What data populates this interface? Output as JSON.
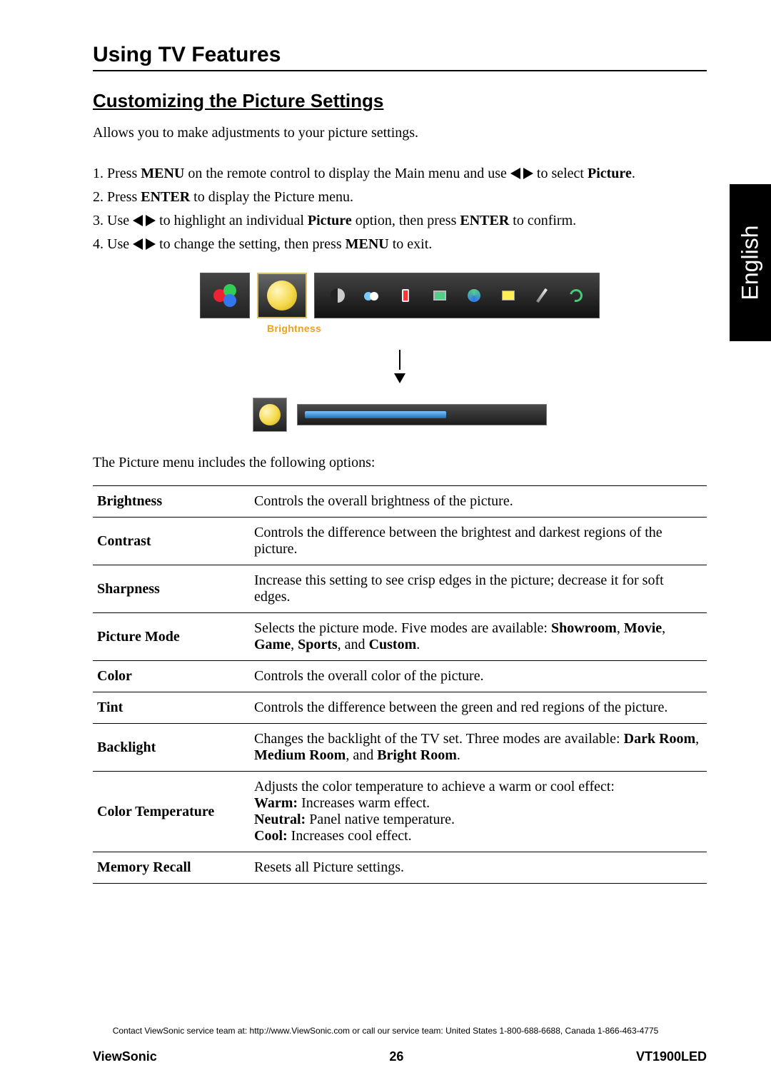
{
  "heading1": "Using TV Features",
  "heading2": "Customizing the Picture Settings",
  "language_tab": "English",
  "intro": "Allows you to make adjustments to your picture settings.",
  "step1": {
    "pre": "Press ",
    "b1": "MENU",
    "mid": " on the remote control to display the Main menu and use ",
    "post": " to select ",
    "b2": "Picture",
    "end": "."
  },
  "step2": {
    "pre": "Press ",
    "b1": "ENTER",
    "post": " to display the Picture menu."
  },
  "step3": {
    "pre": "Use ",
    "mid": " to highlight an individual ",
    "b1": "Picture",
    "mid2": " option, then press ",
    "b2": "ENTER",
    "post": " to confirm."
  },
  "step4": {
    "pre": "Use ",
    "mid": " to change the setting, then press ",
    "b1": "MENU",
    "post": " to exit."
  },
  "osd_label": "Brightness",
  "options_intro": "The Picture menu includes the following options:",
  "options": [
    {
      "name": "Brightness",
      "desc_plain": "Controls the overall brightness of the picture."
    },
    {
      "name": "Contrast",
      "desc_plain": "Controls the difference between the brightest and darkest regions of the picture."
    },
    {
      "name": "Sharpness",
      "desc_plain": "Increase this setting to see crisp edges in the picture; decrease it for soft edges."
    },
    {
      "name": "Picture Mode",
      "desc_pre": "Selects the picture mode. Five modes are available: ",
      "b1": "Showroom",
      "sep1": ", ",
      "b2": "Movie",
      "sep2": ", ",
      "b3": "Game",
      "sep3": ", ",
      "b4": "Sports",
      "sep4": ", and ",
      "b5": "Custom",
      "end": "."
    },
    {
      "name": "Color",
      "desc_plain": "Controls the overall color of the picture."
    },
    {
      "name": "Tint",
      "desc_plain": "Controls the difference between the green and red regions of the picture."
    },
    {
      "name": "Backlight",
      "desc_pre": "Changes the backlight of the TV set. Three modes are available: ",
      "b1": "Dark Room",
      "sep1": ", ",
      "b2": "Medium Room",
      "sep2": ", and ",
      "b3": "Bright Room",
      "end": "."
    },
    {
      "name": "Color Temperature",
      "line1": "Adjusts the color temperature to achieve a warm or cool effect:",
      "l2b": "Warm:",
      "l2": " Increases warm effect.",
      "l3b": "Neutral:",
      "l3": " Panel native temperature.",
      "l4b": "Cool:",
      "l4": " Increases cool effect."
    },
    {
      "name": "Memory Recall",
      "desc_plain": "Resets all Picture settings."
    }
  ],
  "footer_contact": "Contact ViewSonic service team at: http://www.ViewSonic.com or call our service team: United States 1-800-688-6688, Canada 1-866-463-4775",
  "footer": {
    "brand": "ViewSonic",
    "page": "26",
    "model": "VT1900LED"
  }
}
